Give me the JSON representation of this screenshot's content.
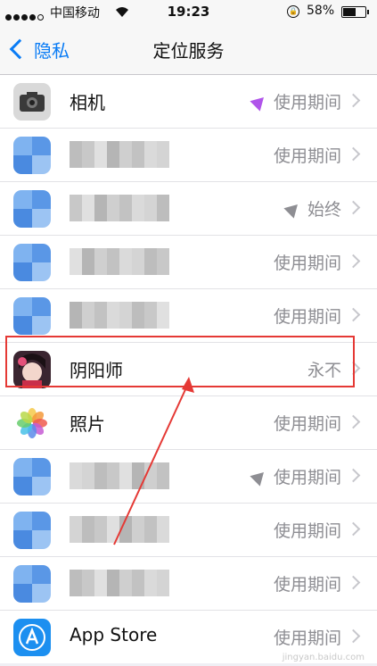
{
  "status_bar": {
    "carrier": "中国移动",
    "time": "19:23",
    "battery": "58%",
    "battery_level": 0.58
  },
  "nav": {
    "back_label": "隐私",
    "title": "定位服务"
  },
  "rows": [
    {
      "name": "相机",
      "permission": "使用期间",
      "location_arrow": "purple",
      "icon": "camera-icon"
    },
    {
      "name": "",
      "permission": "使用期间",
      "location_arrow": "none",
      "icon": "blurred-app-icon"
    },
    {
      "name": "",
      "permission": "始终",
      "location_arrow": "gray",
      "icon": "blurred-app-icon"
    },
    {
      "name": "",
      "permission": "使用期间",
      "location_arrow": "none",
      "icon": "blurred-app-icon"
    },
    {
      "name": "",
      "permission": "使用期间",
      "location_arrow": "none",
      "icon": "blurred-app-icon"
    },
    {
      "name": "阴阳师",
      "permission": "永不",
      "location_arrow": "none",
      "icon": "onmyoji-icon"
    },
    {
      "name": "照片",
      "permission": "使用期间",
      "location_arrow": "none",
      "icon": "photos-icon"
    },
    {
      "name": "",
      "permission": "使用期间",
      "location_arrow": "gray",
      "icon": "blurred-app-icon"
    },
    {
      "name": "",
      "permission": "使用期间",
      "location_arrow": "none",
      "icon": "blurred-app-icon"
    },
    {
      "name": "",
      "permission": "使用期间",
      "location_arrow": "none",
      "icon": "blurred-app-icon"
    },
    {
      "name": "App Store",
      "permission": "使用期间",
      "location_arrow": "none",
      "icon": "app-store-icon"
    }
  ],
  "colors": {
    "accent": "#0a7cf5",
    "highlight": "#e53935",
    "location_purple": "#b054ea"
  },
  "watermark": "jingyan.baidu.com"
}
